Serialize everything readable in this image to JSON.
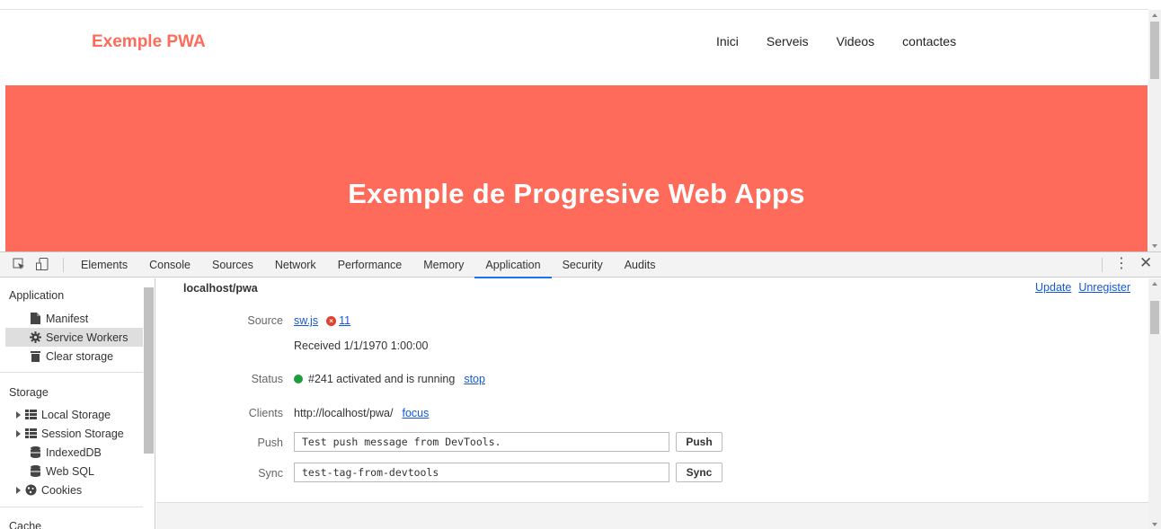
{
  "page": {
    "logo": "Exemple PWA",
    "nav": [
      "Inici",
      "Serveis",
      "Videos",
      "contactes"
    ],
    "hero_title": "Exemple de Progresive Web Apps",
    "colors": {
      "brand": "#ff6b5b",
      "link": "#1558d6",
      "status_ok": "#1e9e3a",
      "error": "#e0412f"
    }
  },
  "devtools": {
    "toolbar": {
      "inspect_icon": "inspect-element-icon",
      "device_icon": "device-toggle-icon",
      "tabs": [
        "Elements",
        "Console",
        "Sources",
        "Network",
        "Performance",
        "Memory",
        "Application",
        "Security",
        "Audits"
      ],
      "active_tab": "Application",
      "menu_icon": "⋮",
      "close_icon": "✕"
    },
    "sidebar": {
      "application": {
        "heading": "Application",
        "items": [
          {
            "label": "Manifest",
            "icon": "file-icon"
          },
          {
            "label": "Service Workers",
            "icon": "gear-icon",
            "selected": true
          },
          {
            "label": "Clear storage",
            "icon": "trash-icon"
          }
        ]
      },
      "storage": {
        "heading": "Storage",
        "items": [
          {
            "label": "Local Storage",
            "icon": "grid-icon",
            "expandable": true
          },
          {
            "label": "Session Storage",
            "icon": "grid-icon",
            "expandable": true
          },
          {
            "label": "IndexedDB",
            "icon": "database-icon"
          },
          {
            "label": "Web SQL",
            "icon": "database-icon"
          },
          {
            "label": "Cookies",
            "icon": "cookie-icon",
            "expandable": true
          }
        ]
      },
      "cache": {
        "heading": "Cache"
      }
    },
    "service_worker": {
      "origin": "localhost/pwa",
      "update_link": "Update",
      "unregister_link": "Unregister",
      "source_label": "Source",
      "source_file": "sw.js",
      "error_count": "11",
      "received": "Received 1/1/1970 1:00:00",
      "status_label": "Status",
      "status_text": "#241 activated and is running",
      "stop_link": "stop",
      "clients_label": "Clients",
      "clients_url": "http://localhost/pwa/",
      "focus_link": "focus",
      "push_label": "Push",
      "push_value": "Test push message from DevTools.",
      "push_button": "Push",
      "sync_label": "Sync",
      "sync_value": "test-tag-from-devtools",
      "sync_button": "Sync"
    }
  }
}
